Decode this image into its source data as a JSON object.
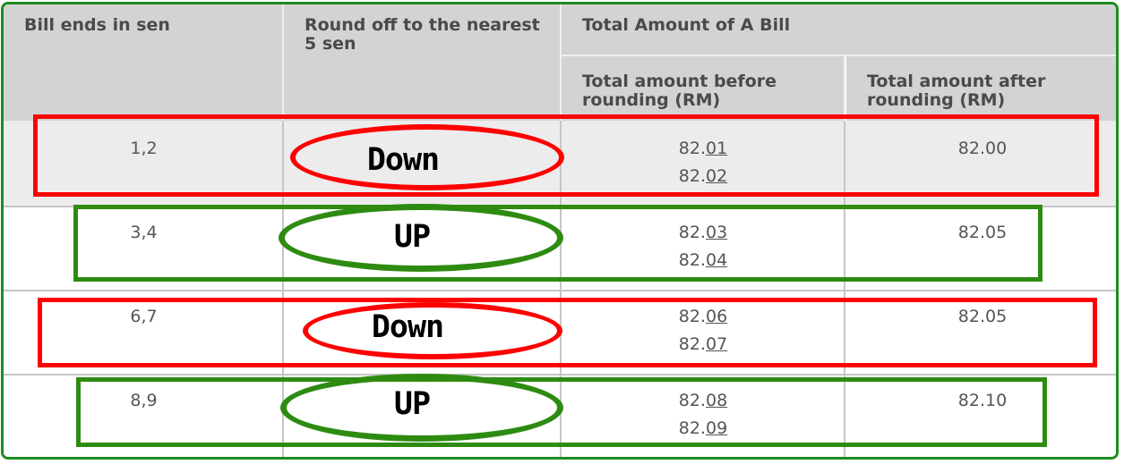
{
  "header": {
    "col1": "Bill ends in sen",
    "col2": "Round off to the nearest 5 sen",
    "group": "Total Amount of A Bill",
    "col3": "Total amount before rounding (RM)",
    "col4": "Total amount after rounding (RM)"
  },
  "rows": [
    {
      "ends": "1,2",
      "direction": "Down",
      "before": [
        {
          "prefix": "82.",
          "sen": "01"
        },
        {
          "prefix": "82.",
          "sen": "02"
        }
      ],
      "after": "82.00",
      "highlight": "red"
    },
    {
      "ends": "3,4",
      "direction": "UP",
      "before": [
        {
          "prefix": "82.",
          "sen": "03"
        },
        {
          "prefix": "82.",
          "sen": "04"
        }
      ],
      "after": "82.05",
      "highlight": "green"
    },
    {
      "ends": "6,7",
      "direction": "Down",
      "before": [
        {
          "prefix": "82.",
          "sen": "06"
        },
        {
          "prefix": "82.",
          "sen": "07"
        }
      ],
      "after": "82.05",
      "highlight": "red"
    },
    {
      "ends": "8,9",
      "direction": "UP",
      "before": [
        {
          "prefix": "82.",
          "sen": "08"
        },
        {
          "prefix": "82.",
          "sen": "09"
        }
      ],
      "after": "82.10",
      "highlight": "green"
    }
  ],
  "colors": {
    "frame": "#1e8c1e",
    "red": "#ff0000",
    "green": "#2e8b12",
    "header_bg": "#d3d3d3"
  }
}
